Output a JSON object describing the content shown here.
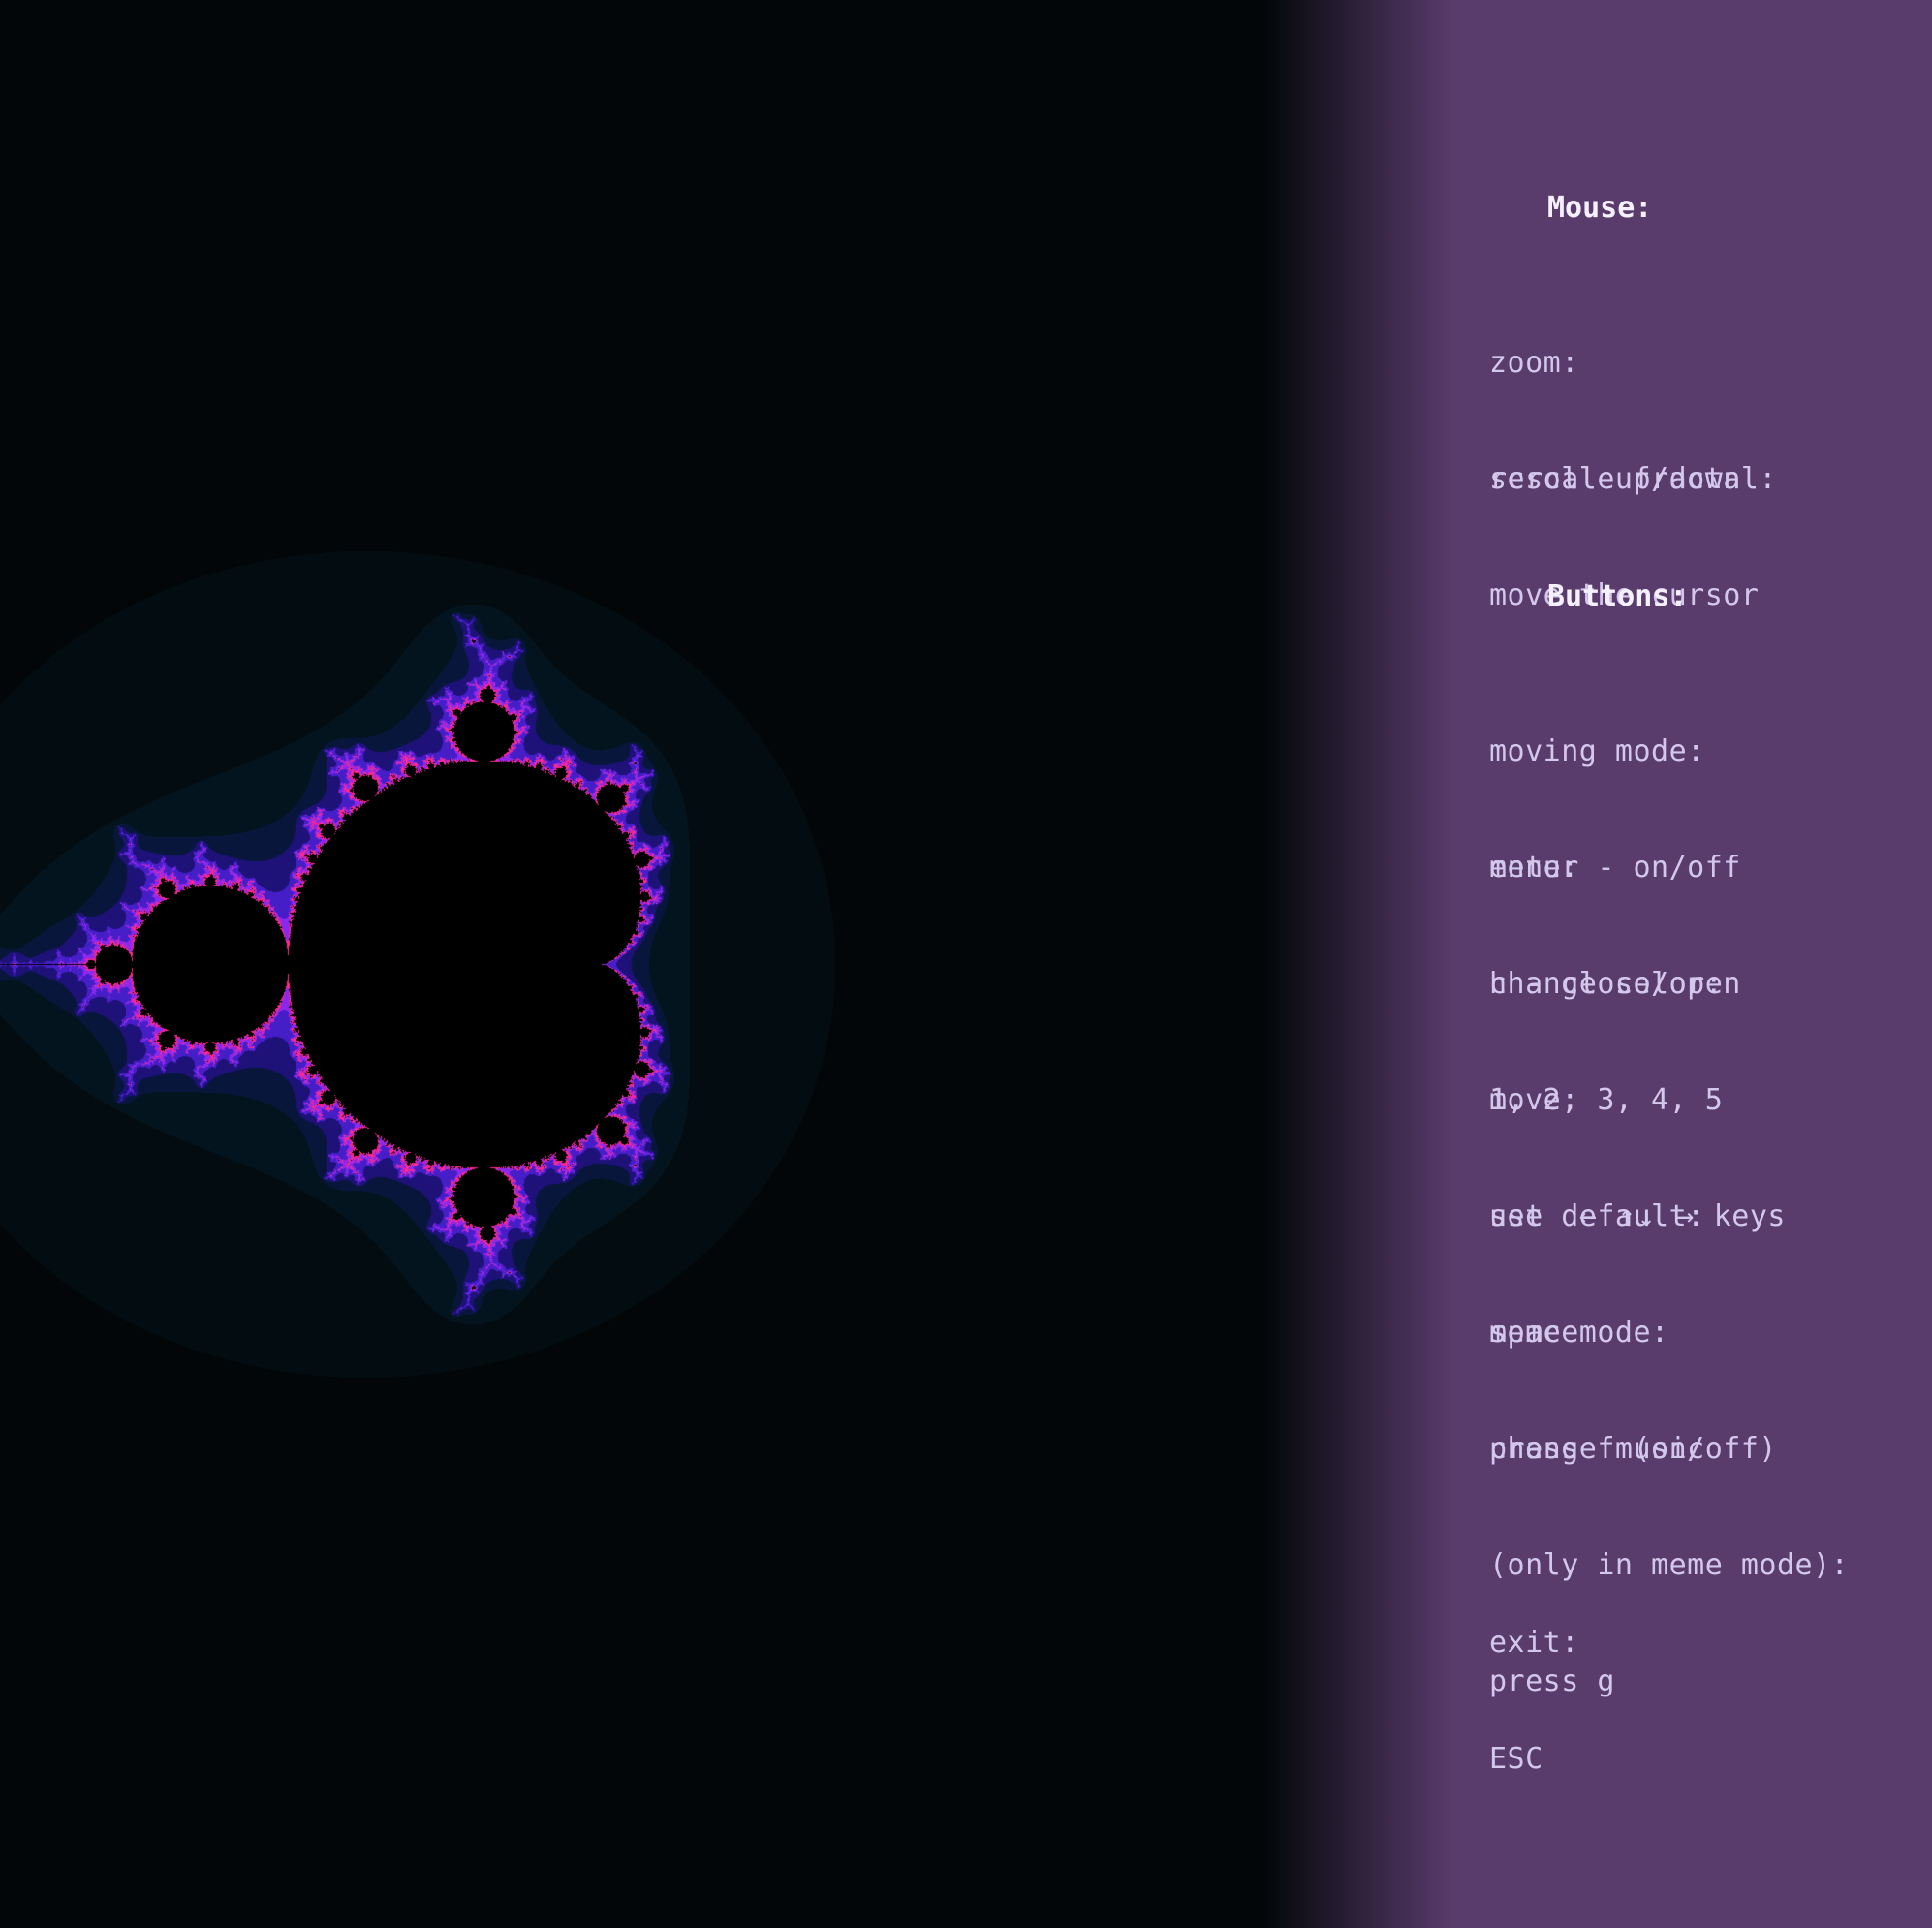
{
  "palette": {
    "background": "#000000",
    "menu_bg": "#593c6c",
    "menu_text": "#d4c7ec",
    "menu_heading": "#f5f0ff",
    "fractal_glow": "#ff2f8a",
    "fractal_violet": "#8a2be2",
    "fractal_blue": "#2a1a8a"
  },
  "fractal": {
    "name": "Mandelbrot set"
  },
  "menu": {
    "mouse_heading": "Mouse:",
    "zoom_label": "zoom:",
    "zoom_value": "scroll up/down",
    "rescale_label": "rescale fractal:",
    "rescale_value": "move the cursor",
    "buttons_heading": "Buttons:",
    "moving_label": "moving mode:",
    "moving_value": "enter - on/off",
    "menu_label": "menu:",
    "menu_value": "h - close/open",
    "color_label": "change color:",
    "color_value": "1, 2, 3, 4, 5",
    "move_label": "move:",
    "move_prefix": "use",
    "move_arrows": "← ↑↓ →",
    "move_suffix": "keys",
    "default_label": "set default:",
    "default_value": "space",
    "meme_label": "meme mode:",
    "meme_value": "press f (on/off)",
    "music_label": "change music",
    "music_label_2": "(only in meme mode):",
    "music_value": "press g",
    "exit_label": "exit:",
    "exit_value": "ESC"
  }
}
